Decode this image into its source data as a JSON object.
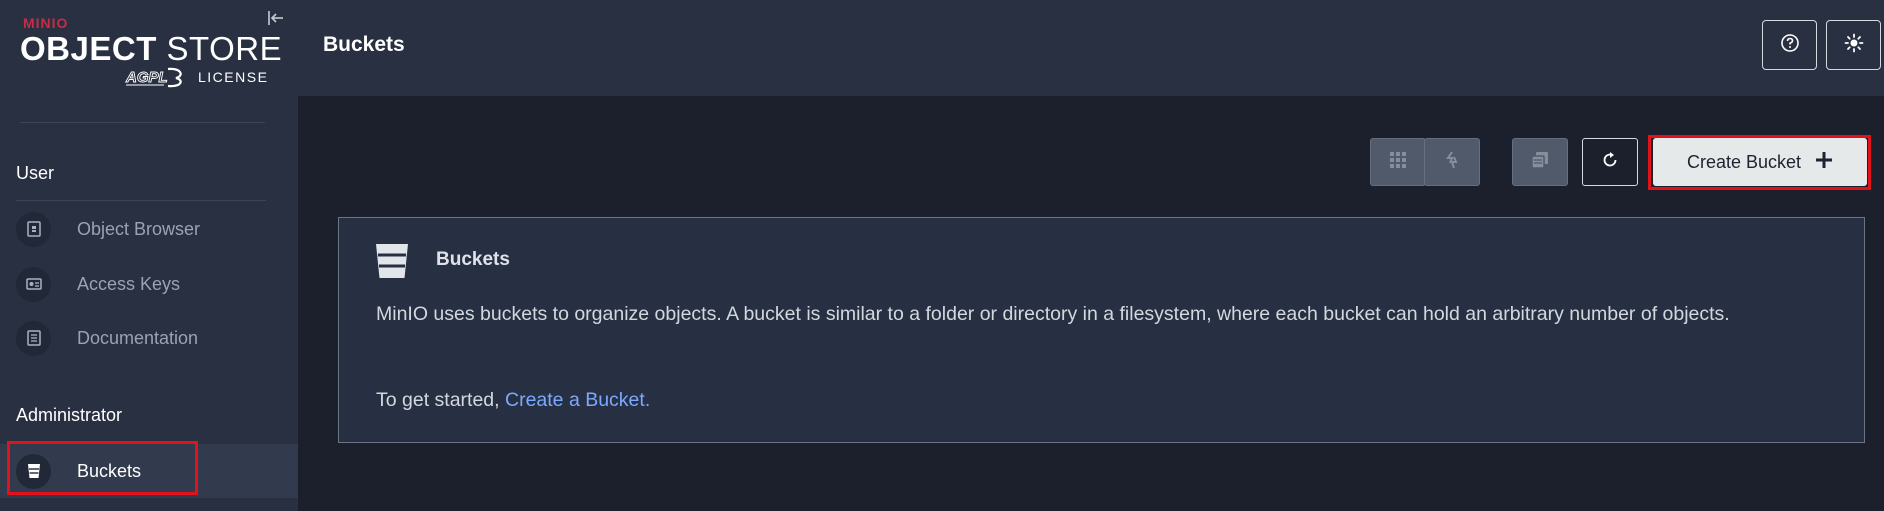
{
  "brand": {
    "minio": "MINIO",
    "title_bold": "OBJECT",
    "title_light": "STORE",
    "license": "LICENSE",
    "agpl": "AGPL"
  },
  "sidebar": {
    "user_section": "User",
    "admin_section": "Administrator",
    "items": [
      {
        "label": "Object Browser",
        "icon": "object-browser-icon"
      },
      {
        "label": "Access Keys",
        "icon": "access-keys-icon"
      },
      {
        "label": "Documentation",
        "icon": "documentation-icon"
      },
      {
        "label": "Buckets",
        "icon": "bucket-icon",
        "active": true
      }
    ]
  },
  "header": {
    "title": "Buckets",
    "help_icon": "help-icon",
    "theme_icon": "sun-icon"
  },
  "toolbar": {
    "buttons": [
      {
        "icon": "grid-icon",
        "disabled": true
      },
      {
        "icon": "replication-icon",
        "disabled": true
      },
      {
        "icon": "lifecycle-icon",
        "disabled": true
      },
      {
        "icon": "refresh-icon",
        "disabled": false
      }
    ],
    "create_label": "Create Bucket",
    "create_icon": "plus-icon"
  },
  "card": {
    "title": "Buckets",
    "description": "MinIO uses buckets to organize objects. A bucket is similar to a folder or directory in a filesystem, where each bucket can hold an arbitrary number of objects.",
    "started_prefix": "To get started,",
    "started_link": "Create a Bucket."
  },
  "colors": {
    "highlight": "#e3121a",
    "link": "#7aa9ff",
    "brand": "#c72c48"
  }
}
